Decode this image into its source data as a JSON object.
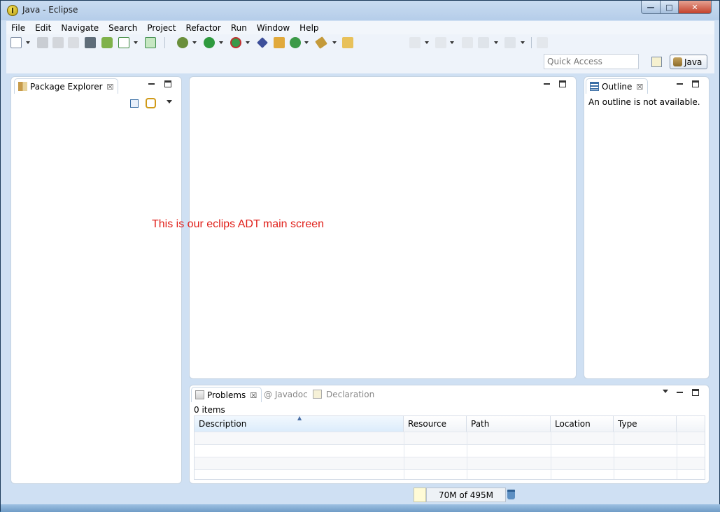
{
  "window": {
    "title": "Java - Eclipse",
    "controls": {
      "minimize": "—",
      "maximize": "□",
      "close": "✕"
    }
  },
  "menu": [
    "File",
    "Edit",
    "Navigate",
    "Search",
    "Project",
    "Refactor",
    "Run",
    "Window",
    "Help"
  ],
  "toolbar": {
    "quick_access_placeholder": "Quick Access",
    "perspective_label": "Java",
    "icons": [
      "new-icon",
      "save-icon",
      "save-all-icon",
      "print-icon",
      "download-icon",
      "android-sdk-icon",
      "check-icon",
      "new-android-icon",
      "debug-icon",
      "run-icon",
      "run-external-icon",
      "bug-icon",
      "new-package-icon",
      "new-class-icon",
      "wand-icon",
      "open-folder-icon",
      "next-annotation-icon",
      "prev-annotation-icon",
      "last-edit-icon",
      "back-icon",
      "forward-icon",
      "pin-icon"
    ]
  },
  "package_explorer": {
    "tab_label": "Package Explorer",
    "close": "☒"
  },
  "outline": {
    "tab_label": "Outline",
    "close": "☒",
    "message": "An outline is not available."
  },
  "editor": {
    "annotation": "This is our eclips ADT main screen"
  },
  "bottom_panel": {
    "tabs": [
      {
        "label": "Problems",
        "active": true
      },
      {
        "label": "@ Javadoc",
        "active": false
      },
      {
        "label": "Declaration",
        "active": false
      }
    ],
    "close": "☒",
    "items_count": "0 items",
    "columns": [
      "Description",
      "Resource",
      "Path",
      "Location",
      "Type"
    ],
    "sort_indicator": "▲"
  },
  "status": {
    "heap": "70M of 495M"
  },
  "colors": {
    "annotation": "#e0201a",
    "frame": "#cfe0f3"
  }
}
